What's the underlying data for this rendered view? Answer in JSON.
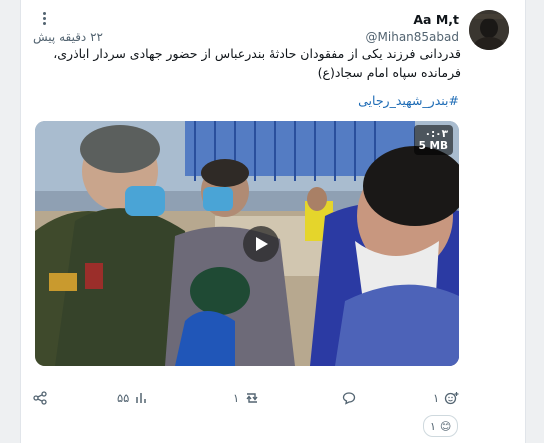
{
  "post": {
    "display_name": "Aa M,t",
    "handle": "@Mihan85abad",
    "timestamp": "۲۲ دقیقه پیش",
    "text": "قدردانی فرزند یکی از مفقودان حادثهٔ بندرعباس از حضور جهادی سردار اباذری، فرمانده سپاه امام سجاد(ع)",
    "hashtag": "#بندر_شهید_رجایی"
  },
  "media": {
    "duration": "۰:۰۳",
    "size": "5 MB"
  },
  "actions": {
    "share_icon": "share-icon",
    "views": "۵۵",
    "reposts": "۱",
    "replies": "",
    "likes": "۱"
  },
  "reaction": {
    "emoji": "😊",
    "count": "۱"
  },
  "colors": {
    "accent": "#1d6bb5",
    "muted": "#536471",
    "like": "#e0245e"
  }
}
